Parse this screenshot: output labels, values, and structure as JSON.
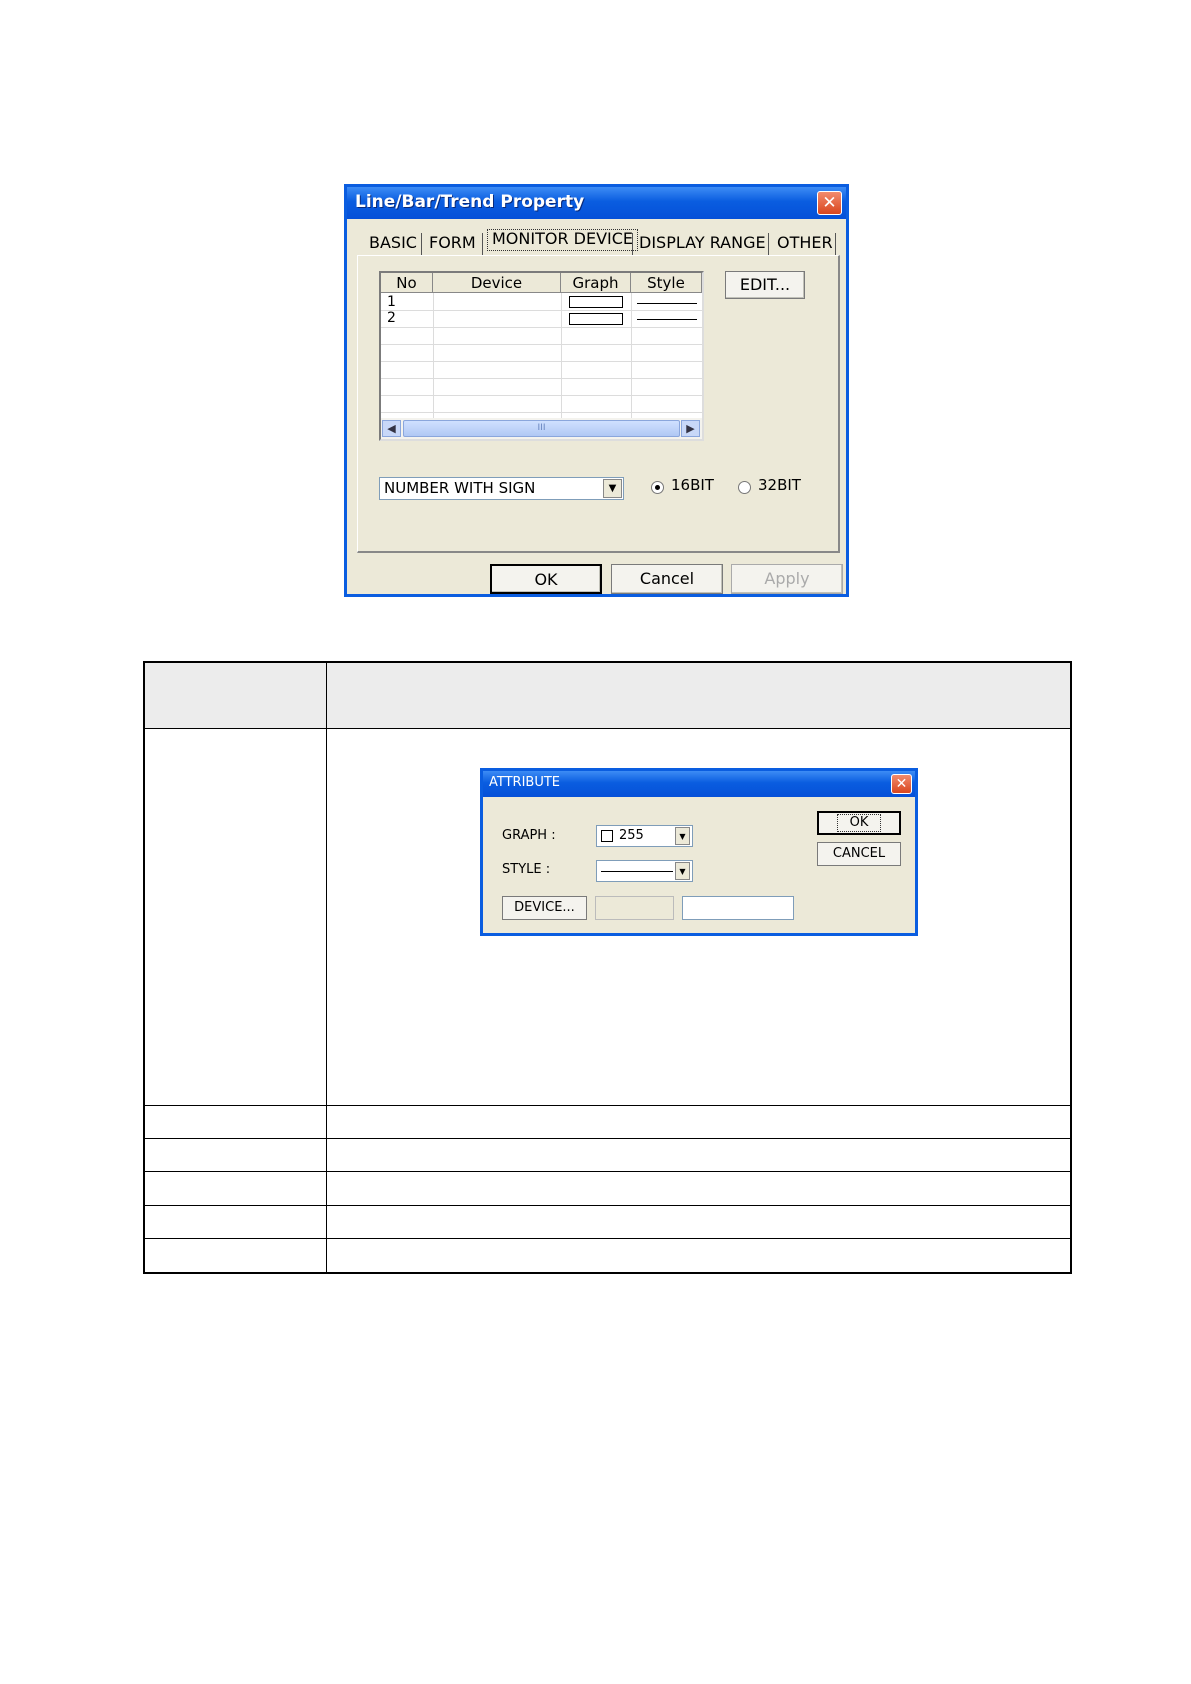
{
  "main_dialog": {
    "title": "Line/Bar/Trend Property",
    "close_glyph": "✕",
    "tabs": [
      "BASIC",
      "FORM",
      "MONITOR DEVICE",
      "DISPLAY RANGE",
      "OTHER"
    ],
    "active_tab": "MONITOR DEVICE",
    "grid": {
      "columns": [
        "No",
        "Device",
        "Graph",
        "Style"
      ],
      "rows": [
        {
          "no": "1",
          "device": "",
          "graph": "",
          "style": ""
        },
        {
          "no": "2",
          "device": "",
          "graph": "",
          "style": ""
        }
      ],
      "scroll_thumb_grip": "III"
    },
    "edit_button": "EDIT...",
    "number_format": "NUMBER WITH SIGN",
    "radio_16": "16BIT",
    "radio_32": "32BIT",
    "selected_bits": "16BIT",
    "buttons": {
      "ok": "OK",
      "cancel": "Cancel",
      "apply": "Apply"
    }
  },
  "attribute_dialog": {
    "title": "ATTRIBUTE",
    "close_glyph": "✕",
    "graph_label": "GRAPH :",
    "graph_value": "255",
    "style_label": "STYLE :",
    "device_button": "DEVICE...",
    "ok": "OK",
    "cancel": "CANCEL"
  },
  "colors": {
    "title_bar": "#0a5de0",
    "dialog_face": "#ece9d8",
    "close_button": "#d9461f"
  }
}
